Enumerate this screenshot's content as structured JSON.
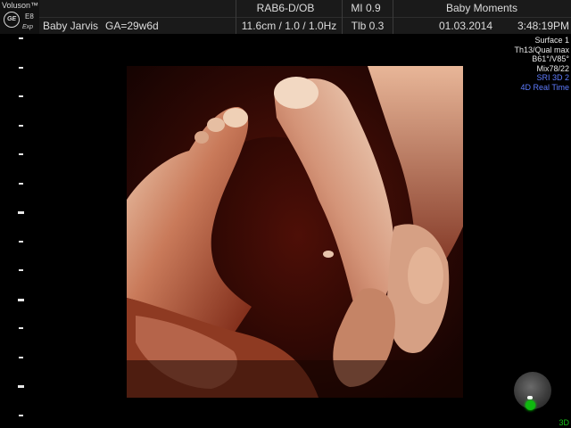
{
  "brand": {
    "name": "Voluson™",
    "logo_text": "GE",
    "model": "E8",
    "submodel": "Exp"
  },
  "header": {
    "patient_name": "Baby Jarvis",
    "gestational_age": "GA=29w6d",
    "probe_preset": "RAB6-D/OB",
    "mi": "MI  0.9",
    "study_label": "Baby Moments",
    "depth_freq": "11.6cm / 1.0 / 1.0Hz",
    "tib": "Tlb  0.3",
    "date": "01.03.2014",
    "time": "3:48:19PM"
  },
  "params": {
    "surface": "Surface 1",
    "threshold": "Th13/Qual max",
    "bright": "B61°/V85°",
    "mix": "Mix78/22",
    "sri": "SRI 3D 2",
    "realtime": "4D Real Time"
  },
  "footer": {
    "mode_label": "3D"
  },
  "colors": {
    "header_bg": "#1a1a1a",
    "param_blue": "#5f7cff",
    "orient_green": "#0fb80f",
    "tissue_dark": "#3a0d07",
    "tissue_mid": "#a8442c",
    "tissue_light": "#efcfb4"
  }
}
